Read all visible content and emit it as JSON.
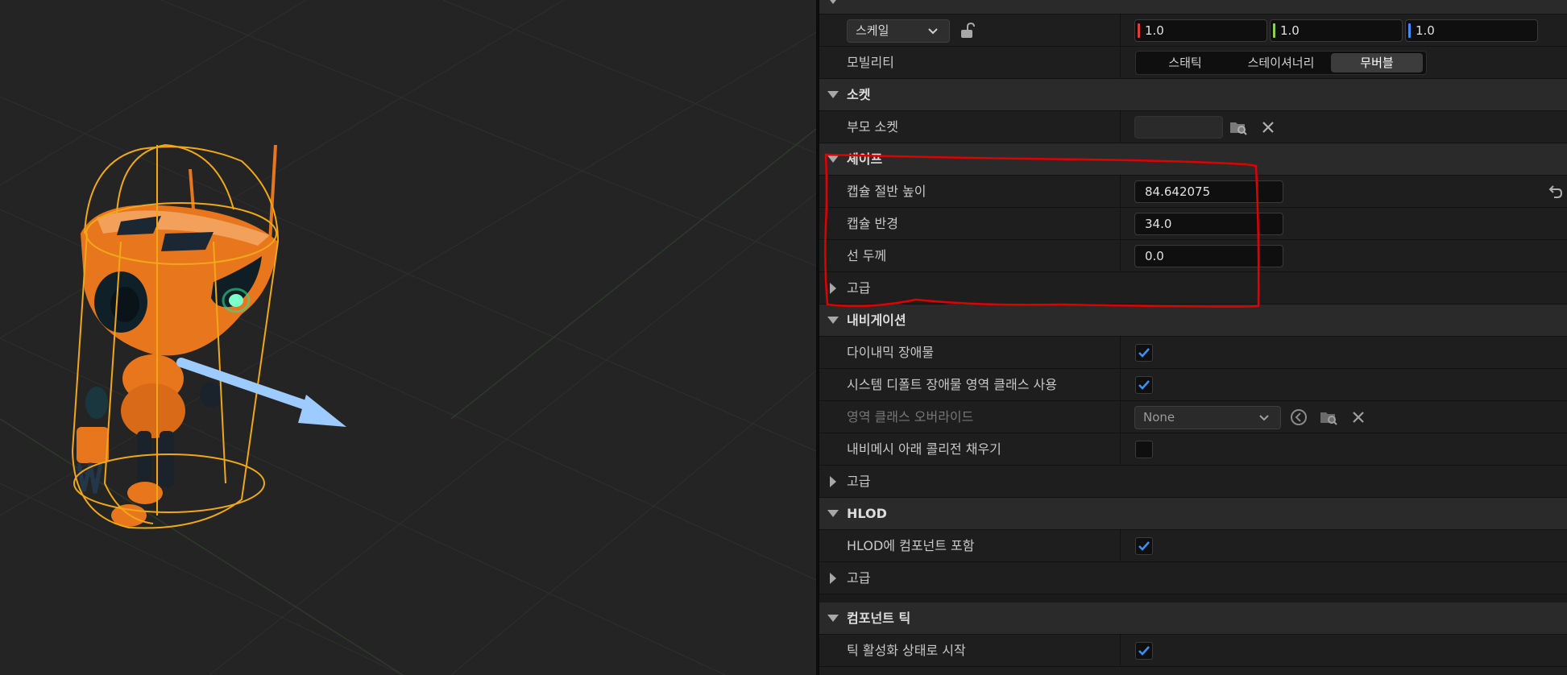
{
  "transform": {
    "scale_mode": "스케일",
    "scale_x": "1.0",
    "scale_y": "1.0",
    "scale_z": "1.0",
    "mobility_label": "모빌리티",
    "mobility_options": [
      "스태틱",
      "스테이셔너리",
      "무버블"
    ],
    "mobility_selected": "무버블"
  },
  "sockets": {
    "header": "소켓",
    "parent_socket_label": "부모 소켓",
    "parent_socket_value": ""
  },
  "shape": {
    "header": "셰이프",
    "capsule_half_height_label": "캡슐 절반 높이",
    "capsule_half_height": "84.642075",
    "capsule_radius_label": "캡슐 반경",
    "capsule_radius": "34.0",
    "line_thickness_label": "선 두께",
    "line_thickness": "0.0",
    "advanced_label": "고급"
  },
  "navigation": {
    "header": "내비게이션",
    "dynamic_obstacle_label": "다이내믹 장애물",
    "dynamic_obstacle": true,
    "use_system_default_area_label": "시스템 디폴트 장애물 영역 클래스 사용",
    "use_system_default_area": true,
    "area_class_override_label": "영역 클래스 오버라이드",
    "area_class_override": "None",
    "fill_collision_label": "내비메시 아래 콜리전 채우기",
    "fill_collision": false,
    "advanced_label": "고급"
  },
  "hlod": {
    "header": "HLOD",
    "include_label": "HLOD에 컴포넌트 포함",
    "include": true,
    "advanced_label": "고급"
  },
  "component_tick": {
    "header": "컴포넌트 틱",
    "start_enabled_label": "틱 활성화 상태로 시작",
    "start_enabled": true
  },
  "colors": {
    "axis_x": "#e03c3c",
    "axis_y": "#8fd14f",
    "axis_z": "#3e8ef7",
    "checkbox": "#3e8ef7",
    "highlight": "#e00000",
    "robot": "#e8761c"
  }
}
